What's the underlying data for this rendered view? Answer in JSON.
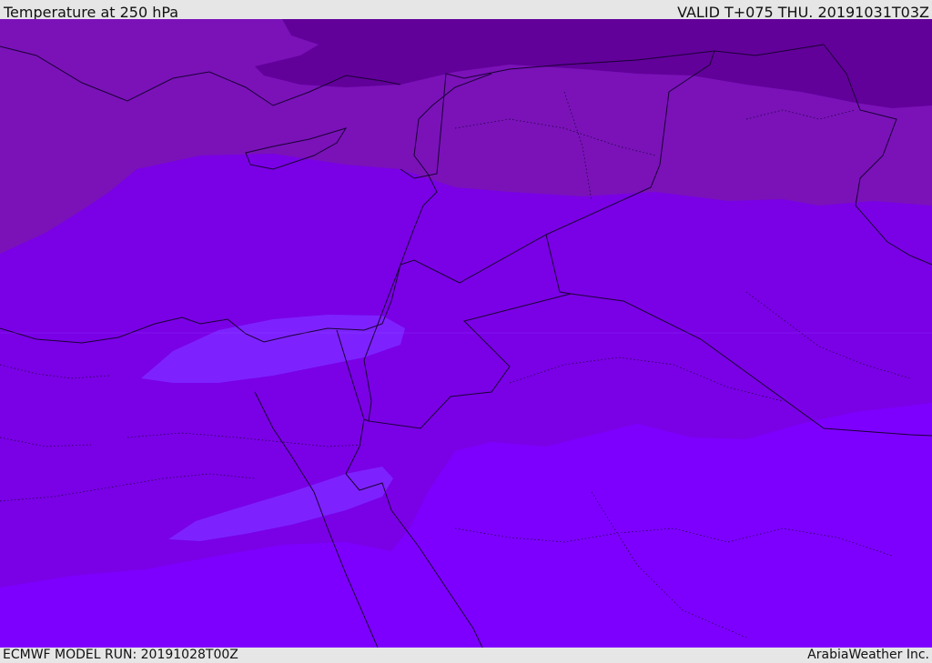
{
  "header": {
    "title": "Temperature at 250 hPa",
    "valid_time": "VALID T+075 THU. 20191031T03Z"
  },
  "footer": {
    "model_run": "ECMWF MODEL RUN: 20191028T00Z",
    "credit": "ArabiaWeather Inc."
  },
  "colors": {
    "coldest": "#62009a",
    "cold": "#7a12b8",
    "mid": "#7a00e6",
    "warm": "#7d00ff",
    "warmest": "#7d22ff",
    "border": "#1a0033"
  }
}
